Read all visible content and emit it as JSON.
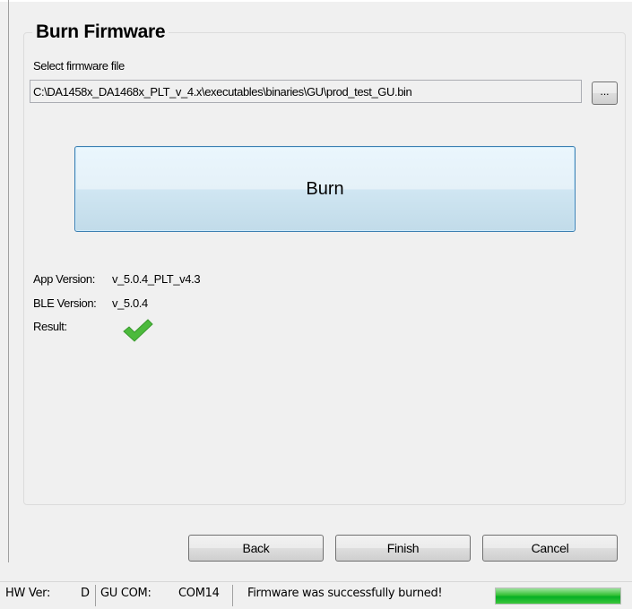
{
  "section": {
    "title": "Burn Firmware"
  },
  "firmware": {
    "select_label": "Select firmware file",
    "path_value": "C:\\DA1458x_DA1468x_PLT_v_4.x\\executables\\binaries\\GU\\prod_test_GU.bin",
    "browse_label": "..."
  },
  "burn_button": {
    "label": "Burn"
  },
  "info": {
    "app_version_label": "App Version:",
    "app_version_value": "v_5.0.4_PLT_v4.3",
    "ble_version_label": "BLE Version:",
    "ble_version_value": "v_5.0.4",
    "result_label": "Result:",
    "result_icon": "checkmark-icon",
    "result_color": "#4cba3c"
  },
  "buttons": {
    "back": "Back",
    "finish": "Finish",
    "cancel": "Cancel"
  },
  "status": {
    "hw_label": "HW Ver:",
    "hw_value": "D",
    "com_label": "GU COM:",
    "com_value": "COM14",
    "message": "Firmware was successfully burned!",
    "progress": 1.0,
    "progress_color": "#06b025"
  }
}
